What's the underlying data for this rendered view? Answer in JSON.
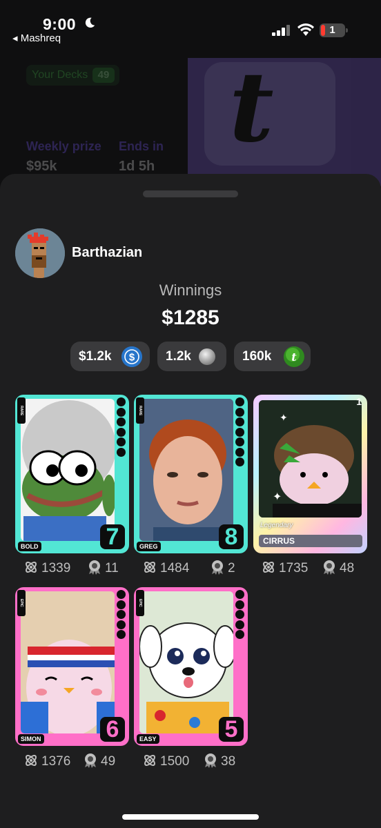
{
  "status_bar": {
    "time": "9:00",
    "back_app": "◂ Mashreq",
    "battery": "1"
  },
  "background_app": {
    "your_decks_label": "Your Decks",
    "your_decks_count": "49",
    "weekly_prize_label": "Weekly prize",
    "weekly_prize_value": "$95k",
    "ends_in_label": "Ends in",
    "ends_in_value": "1d 5h"
  },
  "profile": {
    "username": "Barthazian",
    "winnings_label": "Winnings",
    "winnings_value": "$1285"
  },
  "balances": [
    {
      "value": "$1.2k",
      "icon": "usdc-coin-icon"
    },
    {
      "value": "1.2k",
      "icon": "silver-coin-icon"
    },
    {
      "value": "160k",
      "icon": "green-token-icon"
    }
  ],
  "cards": [
    {
      "name": "BOLD",
      "rarity": "RARE",
      "level": "7",
      "score": "1339",
      "medals": "11"
    },
    {
      "name": "GREG",
      "rarity": "RARE",
      "level": "8",
      "score": "1484",
      "medals": "2"
    },
    {
      "name": "CIRRUS",
      "rarity": "Legendary",
      "level": "1",
      "score": "1735",
      "medals": "48"
    },
    {
      "name": "SIMON",
      "rarity": "EPIC",
      "level": "6",
      "score": "1376",
      "medals": "49"
    },
    {
      "name": "EASY",
      "rarity": "EPIC",
      "level": "5",
      "score": "1500",
      "medals": "38"
    }
  ],
  "colors": {
    "rare": "#52e6d4",
    "epic": "#ff6fc8",
    "sheet": "#1e1e1f",
    "chip": "#3a3a3c",
    "accent_purple": "#7c5cff"
  }
}
